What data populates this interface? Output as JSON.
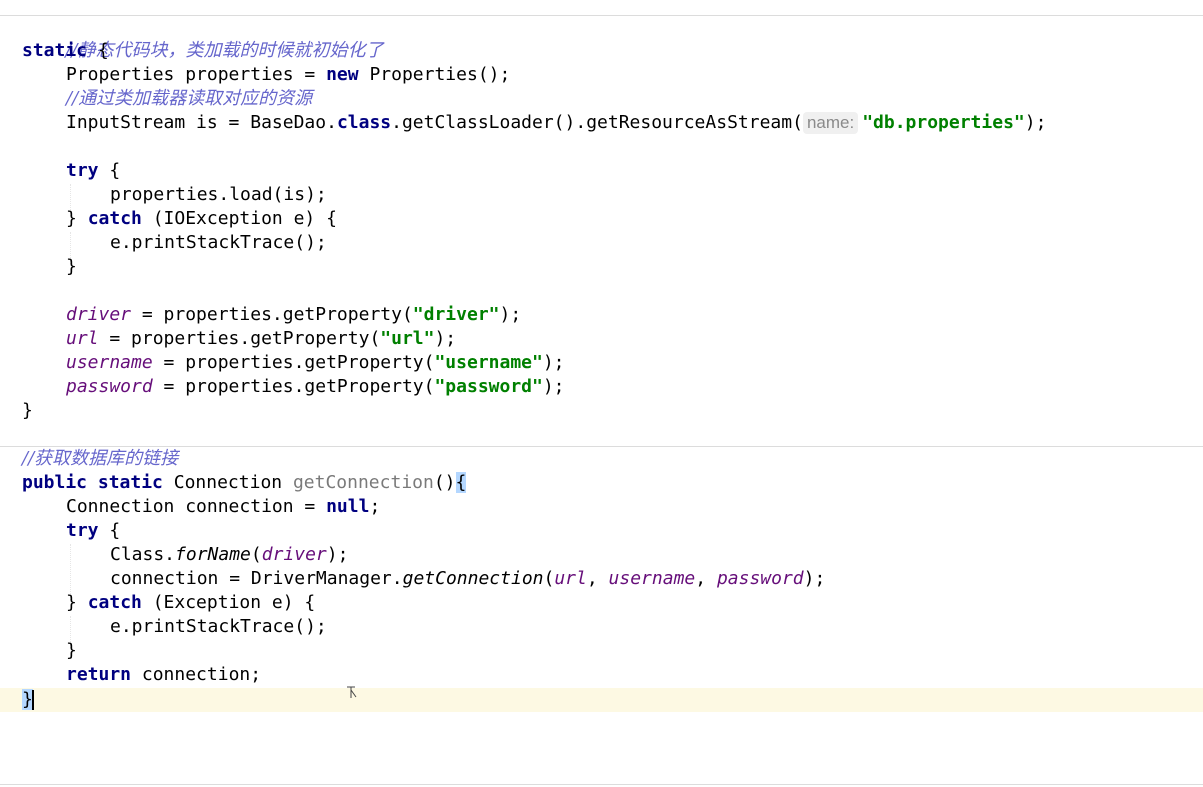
{
  "code": {
    "comment_static_block": "//静态代码块，类加载的时候就初始化了",
    "kw_static": "static",
    "open_brace": " {",
    "l2_type": "Properties properties = ",
    "kw_new": "new",
    "l2_rest": " Properties();",
    "comment_loader": "//通过类加载器读取对应的资源",
    "l4_pre": "InputStream is = BaseDao.",
    "kw_class": "class",
    "l4_mid": ".getClassLoader().getResourceAsStream(",
    "hint_name": "name:",
    "str_db_properties": "\"db.properties\"",
    "l4_end": ");",
    "kw_try": "try",
    "l6_body": "properties.load(is);",
    "close_brace_catch_pre": "} ",
    "kw_catch": "catch",
    "l7_rest": " (IOException e) {",
    "print_stack": "e.printStackTrace();",
    "close_brace": "}",
    "fld_driver": "driver",
    "fld_url": "url",
    "fld_username": "username",
    "fld_password": "password",
    "assign_get": " = properties.getProperty(",
    "str_driver": "\"driver\"",
    "str_url": "\"url\"",
    "str_username": "\"username\"",
    "str_password": "\"password\"",
    "end_call": ");",
    "comment_get_conn": "//获取数据库的链接",
    "kw_public": "public",
    "sp": " ",
    "type_connection": " Connection ",
    "method_get_connection": "getConnection",
    "parens": "()",
    "brace_open": "{",
    "l18_pre": "Connection connection = ",
    "kw_null": "null",
    "semicolon": ";",
    "class_dot": "Class.",
    "for_name": "forName",
    "paren_open": "(",
    "paren_close_semi": ");",
    "conn_assign": "connection = DriverManager.",
    "get_connection_static": "getConnection",
    "comma": ", ",
    "l22_rest": " (Exception e) {",
    "kw_return": "return",
    "return_rest": " connection;"
  }
}
